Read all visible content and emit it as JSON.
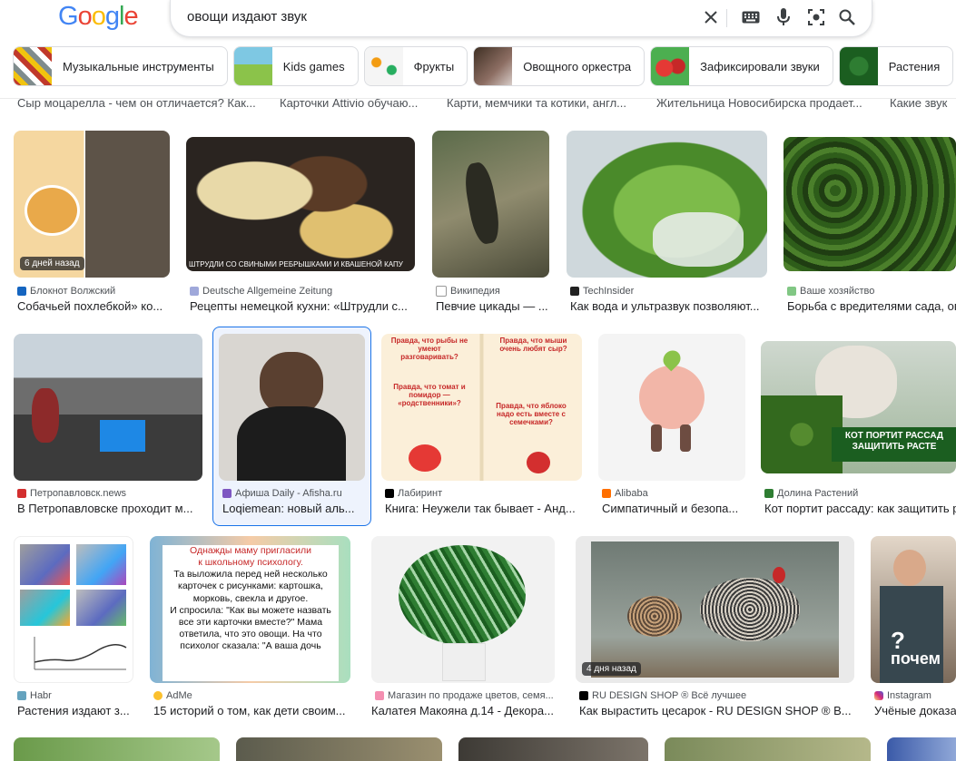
{
  "search": {
    "query": "овощи издают звук"
  },
  "logo": [
    "G",
    "o",
    "o",
    "g",
    "l",
    "e"
  ],
  "logo_colors": [
    "#4285F4",
    "#EA4335",
    "#FBBC05",
    "#4285F4",
    "#34A853",
    "#EA4335"
  ],
  "icons": [
    "close-icon",
    "keyboard-icon",
    "mic-icon",
    "lens-icon",
    "search-icon"
  ],
  "chips": [
    {
      "label": "Музыкальные инструменты"
    },
    {
      "label": "Kids games"
    },
    {
      "label": "Фрукты"
    },
    {
      "label": "Овощного оркестра"
    },
    {
      "label": "Зафиксировали звуки"
    },
    {
      "label": "Растения"
    }
  ],
  "cut_titles": [
    "Сыр моцарелла - чем он отличается? Как...",
    "Карточки Attivio обучаю...",
    "Карти, мемчики та котики, англ...",
    "Жительница Новосибирска продает...",
    "Какие звук"
  ],
  "results": [
    {
      "source": "Блокнот Волжский",
      "title": "Собачьей похлебкой» ко...",
      "badge": "6 дней назад"
    },
    {
      "source": "Deutsche Allgemeine Zeitung",
      "title": "Рецепты немецкой кухни: «Штрудли с...",
      "caption": "ШТРУДЛИ СО СВИНЫМИ РЕБРЫШКАМИ И КВАШЕНОЙ КАПУ"
    },
    {
      "source": "Википедия",
      "title": "Певчие цикады — ..."
    },
    {
      "source": "TechInsider",
      "title": "Как вода и ультразвук позволяют..."
    },
    {
      "source": "Ваше хозяйство",
      "title": "Борьба с вредителями сада, ого"
    },
    {
      "source": "Петропавловск.news",
      "title": "В Петропавловске проходит м..."
    },
    {
      "source": "Афиша Daily - Afisha.ru",
      "title": "Loqiemean: новый аль..."
    },
    {
      "source": "Лабиринт",
      "title": "Книга: Неужели так бывает - Анд...",
      "book_left": "Правда, что рыбы не умеют разговаривать?",
      "book_left2": "Правда, что томат и помидор — «родственники»?",
      "book_right": "Правда, что мыши очень любят сыр?",
      "book_right2": "Правда, что яблоко надо есть вместе с семечками?"
    },
    {
      "source": "Alibaba",
      "title": "Симпатичный и безопа..."
    },
    {
      "source": "Долина Растений",
      "title": "Кот портит рассаду: как защитить ра",
      "overlay": "КОТ ПОРТИТ РАССАД ЗАЩИТИТЬ РАСТЕ"
    },
    {
      "source": "Habr",
      "title": "Растения издают з..."
    },
    {
      "source": "AdMe",
      "title": "15 историй о том, как дети своим...",
      "story": [
        "Однажды маму пригласили",
        "к школьному психологу.",
        "Та выложила перед ней несколько",
        "карточек с рисунками: картошка,",
        "морковь, свекла и другое.",
        "И спросила: \"Как вы можете назвать",
        "все эти карточки вместе?\" Мама",
        "ответила, что это овощи. На что",
        "психолог сказала: \"А ваша дочь"
      ]
    },
    {
      "source": "Магазин по продаже цветов, семя...",
      "title": "Калатея Макояна д.14 - Декора..."
    },
    {
      "source": "RU DESIGN SHOP ® Всё лучшее",
      "title": "Как вырастить цесарок - RU DESIGN SHOP ® В...",
      "badge": "4 дня назад"
    },
    {
      "source": "Instagram",
      "title": "Учёные доказа",
      "overlay": "почем"
    }
  ],
  "colors": {
    "accent": "#1a73e8",
    "text": "#202124",
    "muted": "#4d5156"
  }
}
